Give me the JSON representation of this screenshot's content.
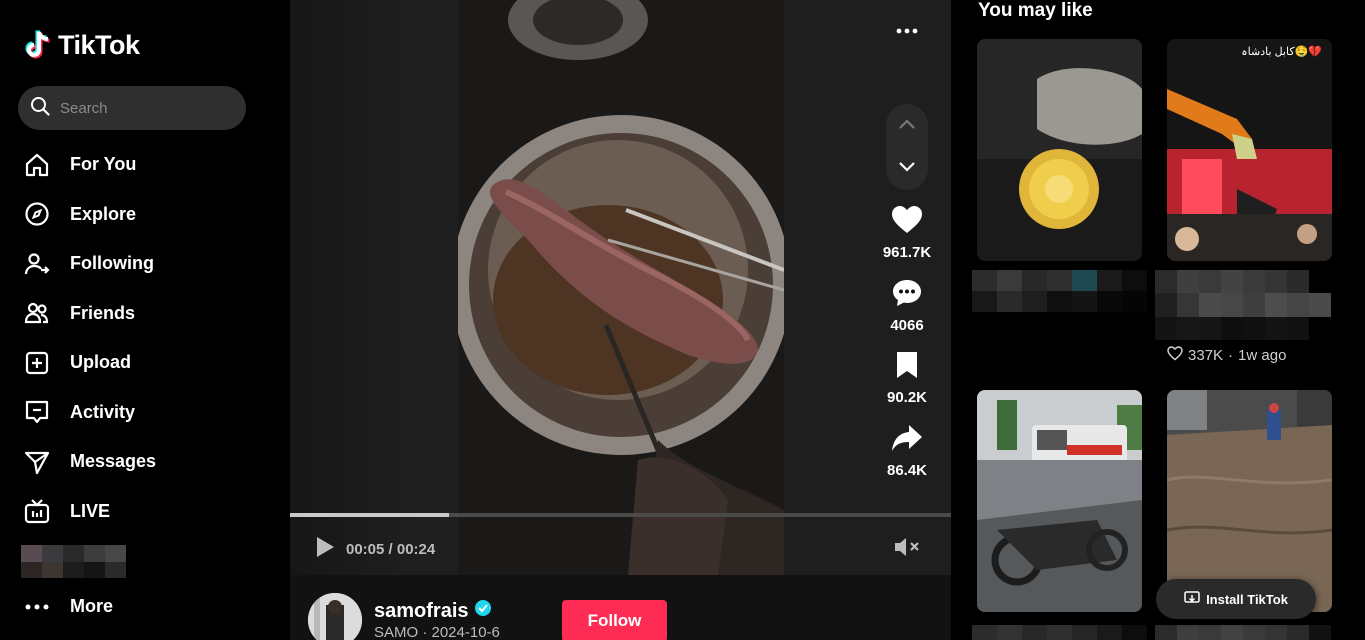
{
  "app": {
    "name": "TikTok"
  },
  "search": {
    "placeholder": "Search"
  },
  "nav": {
    "items": [
      {
        "label": "For You"
      },
      {
        "label": "Explore"
      },
      {
        "label": "Following"
      },
      {
        "label": "Friends"
      },
      {
        "label": "Upload"
      },
      {
        "label": "Activity"
      },
      {
        "label": "Messages"
      },
      {
        "label": "LIVE"
      }
    ],
    "more_label": "More"
  },
  "video": {
    "current_time": "00:05",
    "duration": "00:24",
    "time_display": "00:05 / 00:24",
    "progress_fraction": 0.24
  },
  "actions": {
    "likes": "961.7K",
    "comments": "4066",
    "saves": "90.2K",
    "shares": "86.4K"
  },
  "author": {
    "username": "samofrais",
    "subline": "SAMO · 2024-10-6",
    "follow_label": "Follow"
  },
  "recommendations": {
    "title": "You may like",
    "items": [
      {
        "caption_text": "",
        "meta": ""
      },
      {
        "overlay_text": "کابل بادشاہ🤤💔",
        "likes": "337K",
        "age": "1w ago"
      },
      {
        "caption_text": ""
      },
      {
        "caption_text": ""
      }
    ],
    "second_meta_sep": "·"
  },
  "install": {
    "label": "Install TikTok"
  },
  "colors": {
    "accent": "#fe2c55",
    "bg": "#000000",
    "verified": "#20d5ec"
  }
}
